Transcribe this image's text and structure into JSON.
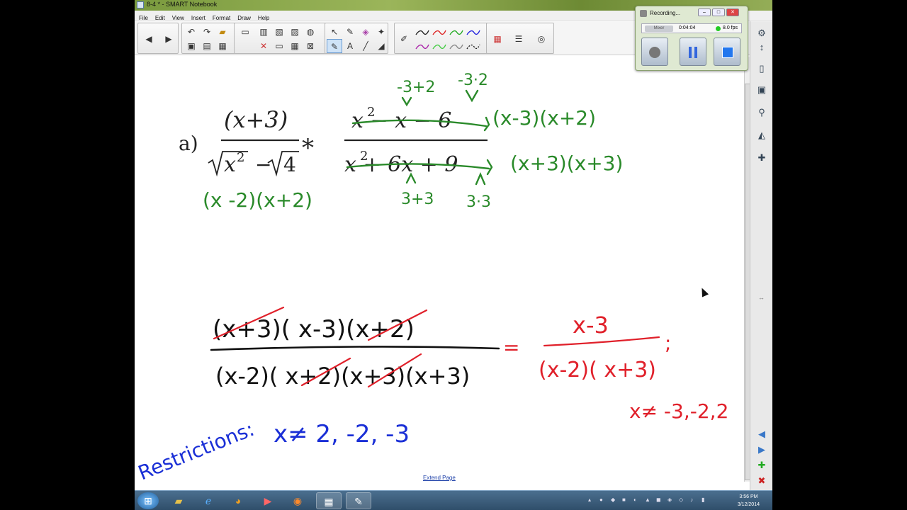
{
  "window": {
    "title": "8-4 * - SMART Notebook",
    "minimize": "–",
    "maximize": "□",
    "close": "✕"
  },
  "menu": [
    "File",
    "Edit",
    "View",
    "Insert",
    "Format",
    "Draw",
    "Help"
  ],
  "toolbar": {
    "icons": [
      "back-arrow-icon",
      "forward-arrow-icon",
      "undo-icon",
      "redo-icon",
      "open-folder-icon",
      "screen-shade-icon",
      "paste-icon",
      "screen-capture-icon",
      "capture-toolbar-icon",
      "table-icon",
      "delete-icon",
      "select-icon",
      "magic-pen-icon",
      "text-icon",
      "line-icon",
      "eraser-icon",
      "fill-icon",
      "color-palette-icon",
      "properties-icon",
      "pen-icon"
    ]
  },
  "recorder": {
    "title": "Recording...",
    "source_label": "Mixer",
    "elapsed": "0:04:04",
    "fps": "8.0 fps"
  },
  "page": {
    "extend_link": "Extend Page"
  },
  "problem": {
    "label": "a)",
    "operator": "*",
    "num1": "(x+3)",
    "den1_a": "x",
    "den1_b": "−",
    "den1_c": "4",
    "num2": "x  − x − 6",
    "den2": "x  + 6x + 9",
    "sq": "2",
    "ink_num2_left": "-3+2",
    "ink_num2_right": "-3·2",
    "ink_num2_factored": "(x-3)(x+2)",
    "ink_den2_factored": "(x+3)(x+3)",
    "ink_den2_left": "3+3",
    "ink_den2_right": "3·3",
    "ink_den1_factored": "(x -2)(x+2)"
  },
  "work": {
    "numerator": "(x+3)( x-3)(x+2)",
    "denominator": "(x-2)( x+2)(x+3)(x+3)",
    "equals": "=",
    "result_num": "x-3",
    "result_den": "(x-2)( x+3)",
    "semicolon": ";",
    "result_restriction": "x≠ -3,-2,2",
    "restrictions_label": "Restrictions:",
    "restrictions_value": "x≠ 2, -2, -3"
  },
  "taskbar": {
    "time": "3:56 PM",
    "date": "3/12/2014"
  }
}
